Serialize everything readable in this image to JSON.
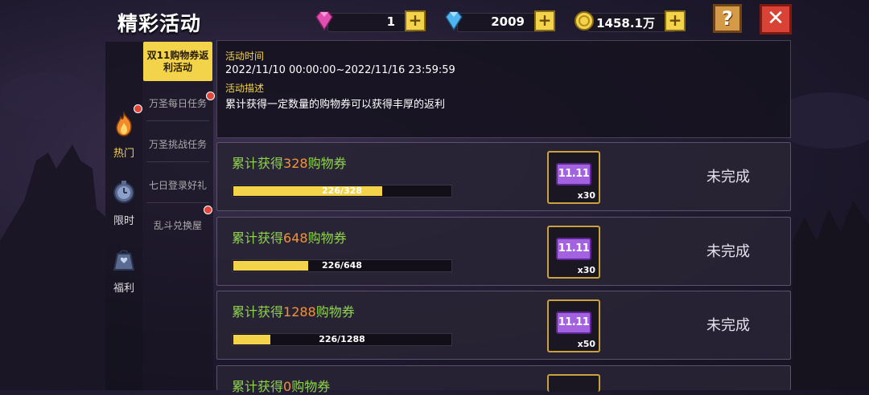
{
  "header": {
    "title": "精彩活动"
  },
  "currencies": [
    {
      "icon": "gem-icon",
      "value": "1"
    },
    {
      "icon": "diamond-icon",
      "value": "2009"
    },
    {
      "icon": "coin-icon",
      "value": "1458.1万"
    }
  ],
  "buttons": {
    "help": "?",
    "close": "✕",
    "plus": "+"
  },
  "categories": [
    {
      "label": "热门",
      "icon": "flame-icon",
      "active": true,
      "badge": true
    },
    {
      "label": "限时",
      "icon": "clock-icon",
      "active": false
    },
    {
      "label": "福利",
      "icon": "gift-bag-icon",
      "active": false
    }
  ],
  "subtabs": [
    {
      "label": "双11购物券返利活动",
      "active": true
    },
    {
      "label": "万圣每日任务",
      "badge": true
    },
    {
      "label": "万圣挑战任务"
    },
    {
      "label": "七日登录好礼"
    },
    {
      "label": "乱斗兑换屋",
      "badge": true
    }
  ],
  "info": {
    "time_label": "活动时间",
    "time_value": "2022/11/10 00:00:00~2022/11/16 23:59:59",
    "desc_label": "活动描述",
    "desc_value": "累计获得一定数量的购物券可以获得丰厚的返利"
  },
  "tasks": [
    {
      "prefix": "累计获得",
      "num": "328",
      "suffix": "购物券",
      "progress_text": "226/328",
      "progress": 0.689,
      "reward_label": "11.11",
      "qty": "x30",
      "status": "未完成"
    },
    {
      "prefix": "累计获得",
      "num": "648",
      "suffix": "购物券",
      "progress_text": "226/648",
      "progress": 0.349,
      "reward_label": "11.11",
      "qty": "x30",
      "status": "未完成"
    },
    {
      "prefix": "累计获得",
      "num": "1288",
      "suffix": "购物券",
      "progress_text": "226/1288",
      "progress": 0.175,
      "reward_label": "11.11",
      "qty": "x50",
      "status": "未完成"
    },
    {
      "prefix": "累计获得",
      "num": "0",
      "suffix": "购物券"
    }
  ]
}
